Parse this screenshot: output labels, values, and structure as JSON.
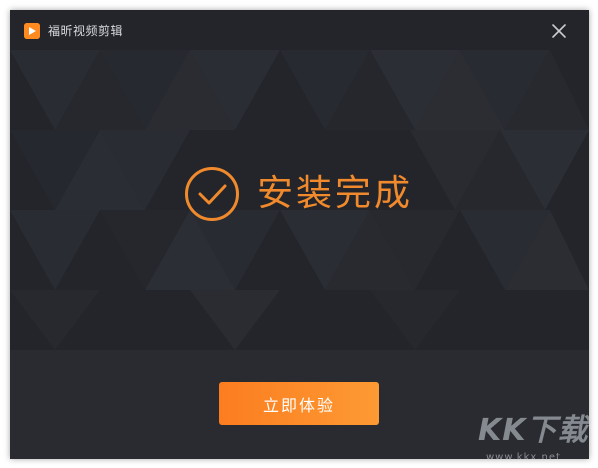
{
  "window": {
    "title": "福昕视频剪辑",
    "logo_icon": "play-logo-icon",
    "close_icon": "close-icon"
  },
  "status": {
    "icon": "check-circle-icon",
    "text": "安装完成"
  },
  "actions": {
    "primary_label": "立即体验"
  },
  "watermark": {
    "brand": "KK下载",
    "url": "www.kkx.net"
  },
  "colors": {
    "accent": "#f08a2c",
    "button_start": "#fc7d1f",
    "button_end": "#fd9a33",
    "background": "#25272d"
  }
}
